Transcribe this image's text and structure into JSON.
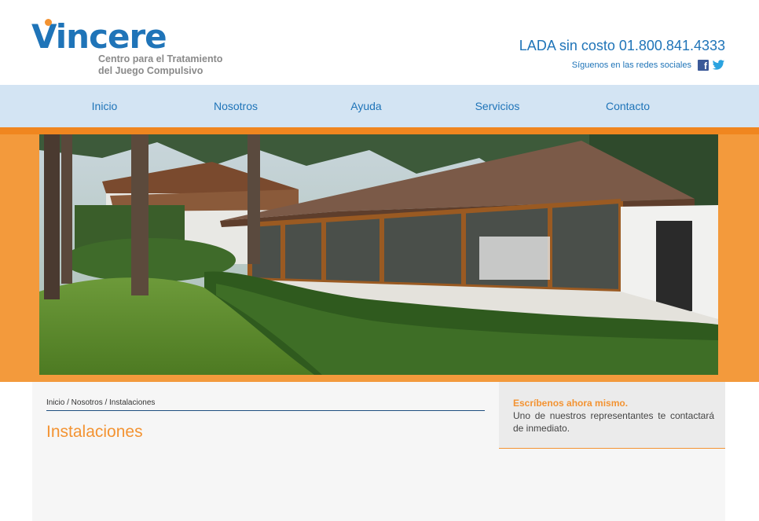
{
  "header": {
    "logo_word": "Vincere",
    "logo_line1": "Centro para el Tratamiento",
    "logo_line2": "del Juego Compulsivo",
    "phone": "LADA sin costo 01.800.841.4333",
    "social_text": "Síguenos en las redes sociales"
  },
  "nav": {
    "items": [
      {
        "label": "Inicio"
      },
      {
        "label": "Nosotros"
      },
      {
        "label": "Ayuda"
      },
      {
        "label": "Servicios"
      },
      {
        "label": "Contacto"
      }
    ]
  },
  "breadcrumb": "Inicio / Nosotros / Instalaciones",
  "page_title": "Instalaciones",
  "sidebar": {
    "title": "Escríbenos ahora mismo.",
    "text": "Uno de nuestros representantes te contactará de inmediato."
  },
  "colors": {
    "brand_blue": "#1f74b8",
    "accent_orange": "#f39332",
    "nav_bg": "#d3e4f3"
  },
  "icons": [
    "facebook-icon",
    "twitter-icon"
  ]
}
